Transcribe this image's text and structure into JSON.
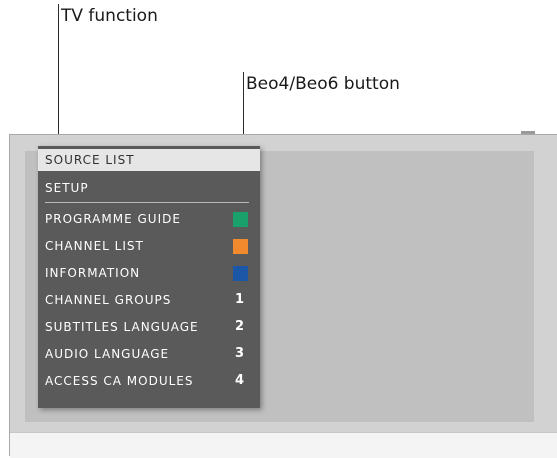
{
  "callouts": {
    "tv_function": "TV function",
    "button": "Beo4/Beo6 button"
  },
  "menu": {
    "items": [
      {
        "label": "SOURCE LIST",
        "selected": true
      },
      {
        "label": "SETUP"
      },
      {
        "label": "PROGRAMME GUIDE",
        "key_color": "#1aa06a"
      },
      {
        "label": "CHANNEL LIST",
        "key_color": "#f08a2c"
      },
      {
        "label": "INFORMATION",
        "key_color": "#1b57a6"
      },
      {
        "label": "CHANNEL GROUPS",
        "key_label": "1"
      },
      {
        "label": "SUBTITLES LANGUAGE",
        "key_label": "2"
      },
      {
        "label": "AUDIO LANGUAGE",
        "key_label": "3"
      },
      {
        "label": "ACCESS CA MODULES",
        "key_label": "4"
      }
    ]
  }
}
